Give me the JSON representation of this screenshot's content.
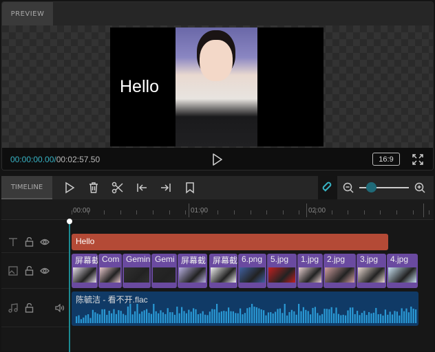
{
  "preview": {
    "tab_label": "PREVIEW",
    "overlay_text": "Hello",
    "current_time": "00:00:00.00",
    "separator": "/",
    "total_time": "00:02:57.50",
    "aspect_ratio": "16:9"
  },
  "timeline": {
    "tab_label": "TIMELINE",
    "accent": "#37b3c4",
    "tools": [
      "play-icon",
      "delete-icon",
      "scissors-icon",
      "jump-start-icon",
      "jump-end-icon",
      "bookmark-icon"
    ],
    "zoom_slider_fraction": 0.2,
    "ruler": [
      "00:00",
      "01:00",
      "02:00"
    ],
    "text_track": {
      "clips": [
        {
          "label": "Hello",
          "color": "#b44a36"
        }
      ]
    },
    "image_track": {
      "color": "#6a4aa0",
      "clips": [
        {
          "label": "屏幕截"
        },
        {
          "label": "Com"
        },
        {
          "label": "Gemin"
        },
        {
          "label": "Gemi"
        },
        {
          "label": "屏幕截"
        },
        {
          "label": "屏幕截"
        },
        {
          "label": "6.png"
        },
        {
          "label": "5.jpg"
        },
        {
          "label": "1.jpg"
        },
        {
          "label": "2.jpg"
        },
        {
          "label": "3.jpg"
        },
        {
          "label": "4.jpg"
        }
      ]
    },
    "audio_track": {
      "clip": "陈毓洁 - 看不开.flac",
      "color": "#103a66"
    }
  }
}
